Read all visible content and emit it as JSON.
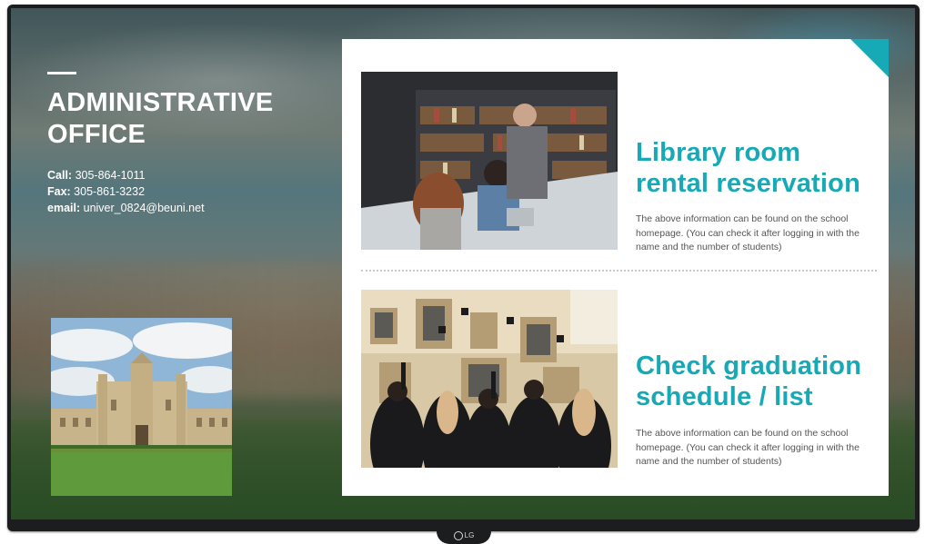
{
  "office": {
    "title": "ADMINISTRATIVE\nOFFICE",
    "contacts": [
      {
        "label": "Call:",
        "value": " 305-864-1011"
      },
      {
        "label": "Fax:",
        "value": " 305-861-3232"
      },
      {
        "label": "email:",
        "value": " univer_0824@beuni.net"
      }
    ]
  },
  "items": [
    {
      "heading": "Library room\nrental reservation",
      "description": "The above information can be found on the school homepage. (You can check it after logging in with the name and the number of students)"
    },
    {
      "heading": "Check graduation\nschedule / list",
      "description": "The above information can be found on the school homepage. (You can check it after logging in with the name and the number of students)"
    }
  ],
  "tv_brand": "LG",
  "colors": {
    "accent": "#17a9b5",
    "bezel": "#1c1d1f"
  }
}
